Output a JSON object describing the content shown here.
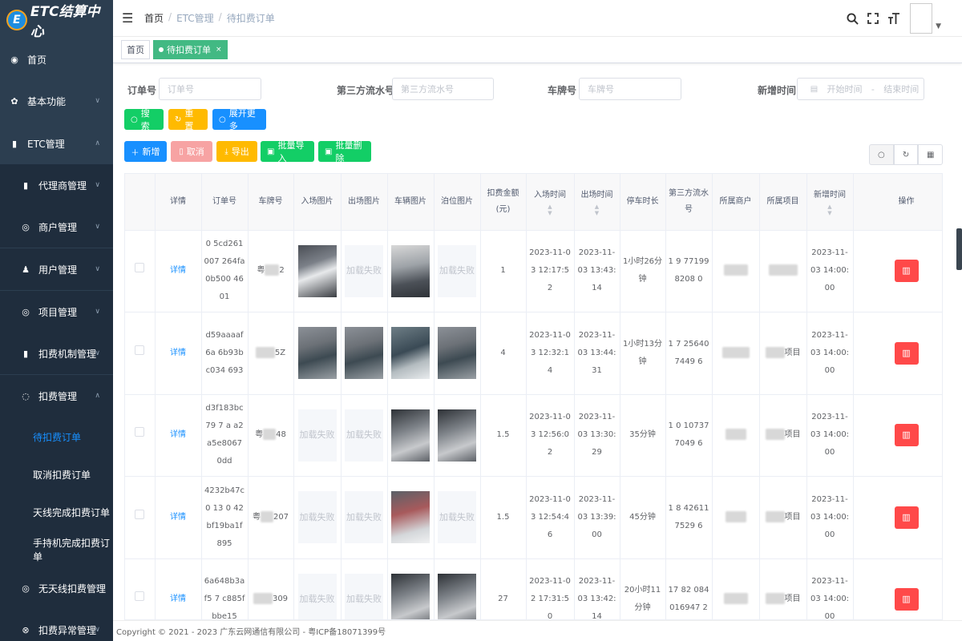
{
  "app": {
    "logo_letter": "E",
    "logo_text": "ETC结算中心"
  },
  "sidebar": {
    "items": [
      {
        "label": "首页",
        "icon": "dashboard-icon",
        "arrow": ""
      },
      {
        "label": "基本功能",
        "icon": "gear-icon",
        "arrow": "∨"
      },
      {
        "label": "ETC管理",
        "icon": "etc-icon",
        "arrow": "∧"
      },
      {
        "label": "代理商管理",
        "icon": "agent-icon",
        "arrow": "∨"
      },
      {
        "label": "商户管理",
        "icon": "merchant-icon",
        "arrow": "∨"
      },
      {
        "label": "用户管理",
        "icon": "user-icon",
        "arrow": "∨"
      },
      {
        "label": "项目管理",
        "icon": "project-icon",
        "arrow": "∨"
      },
      {
        "label": "扣费机制管理",
        "icon": "mechanism-icon",
        "arrow": "∨"
      },
      {
        "label": "扣费管理",
        "icon": "deduction-icon",
        "arrow": "∧"
      },
      {
        "label": "待扣费订单",
        "icon": "",
        "arrow": ""
      },
      {
        "label": "取消扣费订单",
        "icon": "",
        "arrow": ""
      },
      {
        "label": "天线完成扣费订单",
        "icon": "",
        "arrow": ""
      },
      {
        "label": "手持机完成扣费订单",
        "icon": "",
        "arrow": ""
      },
      {
        "label": "无天线扣费管理",
        "icon": "antenna-icon",
        "arrow": "∨"
      },
      {
        "label": "扣费异常管理",
        "icon": "error-icon",
        "arrow": "∨"
      }
    ]
  },
  "breadcrumb": {
    "home": "首页",
    "mid": "ETC管理",
    "current": "待扣费订单"
  },
  "tags": {
    "home": "首页",
    "active": "待扣费订单",
    "close": "×"
  },
  "search": {
    "order_label": "订单号",
    "order_placeholder": "订单号",
    "serial_label": "第三方流水号",
    "serial_placeholder": "第三方流水号",
    "plate_label": "车牌号",
    "plate_placeholder": "车牌号",
    "time_label": "新增时间",
    "start_placeholder": "开始时间",
    "range_sep": "-",
    "end_placeholder": "结束时间"
  },
  "buttons": {
    "search": "搜索",
    "reset": "重置",
    "expand": "展开更多",
    "add": "新增",
    "cancel": "取消",
    "export": "导出",
    "import": "批量导入",
    "batch_delete": "批量删除"
  },
  "table": {
    "headers": [
      "详情",
      "订单号",
      "车牌号",
      "入场图片",
      "出场图片",
      "车辆图片",
      "泊位图片",
      "扣费金额(元)",
      "入场时间",
      "出场时间",
      "停车时长",
      "第三方流水号",
      "所属商户",
      "所属项目",
      "新增时间",
      "操作"
    ],
    "detail_label": "详情",
    "load_failed": "加载失败",
    "rows": [
      {
        "order": "0 5cd261007 264fa0b500 4601",
        "plate_prefix": "粤",
        "plate_suffix": "2",
        "amount": "1",
        "in_time": "2023-11-03 12:17:52",
        "out_time": "2023-11-03 13:43:14",
        "duration": "1小时26分钟",
        "serial": "1 9 771998208 0",
        "merchant_suffix": "",
        "project_suffix": "",
        "created": "2023-11-03 14:00:00"
      },
      {
        "order": "d59aaaaf6a 6b93bc034 693",
        "plate_prefix": "",
        "plate_suffix": "5Z",
        "amount": "4",
        "in_time": "2023-11-03 12:32:14",
        "out_time": "2023-11-03 13:44:31",
        "duration": "1小时13分钟",
        "serial": "1 7 256407449 6",
        "merchant_suffix": "",
        "project_suffix": "项目",
        "created": "2023-11-03 14:00:00"
      },
      {
        "order": "d3f183bc79 7 a a2a5e8067 0dd",
        "plate_prefix": "粤",
        "plate_suffix": "48",
        "amount": "1.5",
        "in_time": "2023-11-03 12:56:02",
        "out_time": "2023-11-03 13:30:29",
        "duration": "35分钟",
        "serial": "1 0 107377049 6",
        "merchant_suffix": "",
        "project_suffix": "项目",
        "created": "2023-11-03 14:00:00"
      },
      {
        "order": "4232b47c0 13 0 42bf19ba1f 895",
        "plate_prefix": "粤",
        "plate_suffix": "207",
        "amount": "1.5",
        "in_time": "2023-11-03 12:54:46",
        "out_time": "2023-11-03 13:39:00",
        "duration": "45分钟",
        "serial": "1 8 426117529 6",
        "merchant_suffix": "",
        "project_suffix": "项目",
        "created": "2023-11-03 14:00:00"
      },
      {
        "order": "6a648b3af5 7 c885fbbe15",
        "plate_prefix": "",
        "plate_suffix": "309",
        "amount": "27",
        "in_time": "2023-11-02 17:31:50",
        "out_time": "2023-11-03 13:42:14",
        "duration": "20小时11分钟",
        "serial": "17 82 084016947 2",
        "merchant_suffix": "",
        "project_suffix": "项目",
        "created": "2023-11-03 14:00:00"
      }
    ]
  },
  "footer": {
    "text": "Copyright © 2021 - 2023 广东云网通信有限公司 - 粤ICP备18071399号"
  }
}
